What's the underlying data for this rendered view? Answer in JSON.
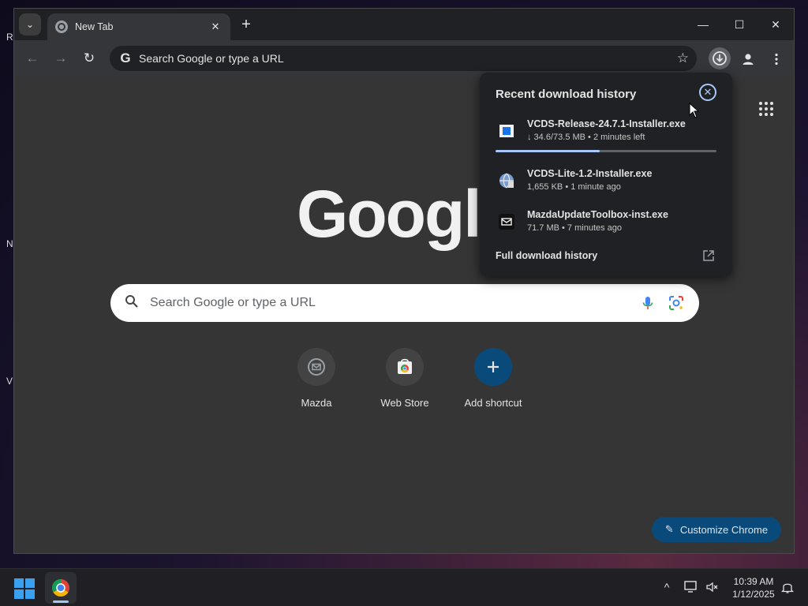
{
  "desktop": {
    "labels": [
      "R",
      "N",
      "V"
    ]
  },
  "browser": {
    "tab": {
      "title": "New Tab",
      "close_label": "✕"
    },
    "newtab_label": "+",
    "window_controls": {
      "minimize": "—",
      "maximize": "☐",
      "close": "✕"
    },
    "toolbar": {
      "back_label": "←",
      "forward_label": "→",
      "reload_label": "↻",
      "omnibox_text": "Search Google or type a URL",
      "star_label": "☆"
    }
  },
  "ntp": {
    "logo_text": "Google",
    "search_placeholder": "Search Google or type a URL",
    "shortcuts": [
      {
        "label": "Mazda",
        "icon": "mail-icon"
      },
      {
        "label": "Web Store",
        "icon": "web-store-icon"
      },
      {
        "label": "Add shortcut",
        "icon": "plus-icon"
      }
    ],
    "customize_label": "Customize Chrome",
    "customize_color": "#0a4a7a"
  },
  "downloads": {
    "title": "Recent download history",
    "items": [
      {
        "name": "VCDS-Release-24.7.1-Installer.exe",
        "meta": "↓ 34.6/73.5 MB • 2 minutes left",
        "progress": 0.47
      },
      {
        "name": "VCDS-Lite-1.2-Installer.exe",
        "meta": "1,655 KB • 1 minute ago"
      },
      {
        "name": "MazdaUpdateToolbox-inst.exe",
        "meta": "71.7 MB • 7 minutes ago"
      }
    ],
    "full_history_label": "Full download history",
    "accent_color": "#a8c7fa"
  },
  "taskbar": {
    "time": "10:39 AM",
    "date": "1/12/2025",
    "chevron_label": "^"
  }
}
